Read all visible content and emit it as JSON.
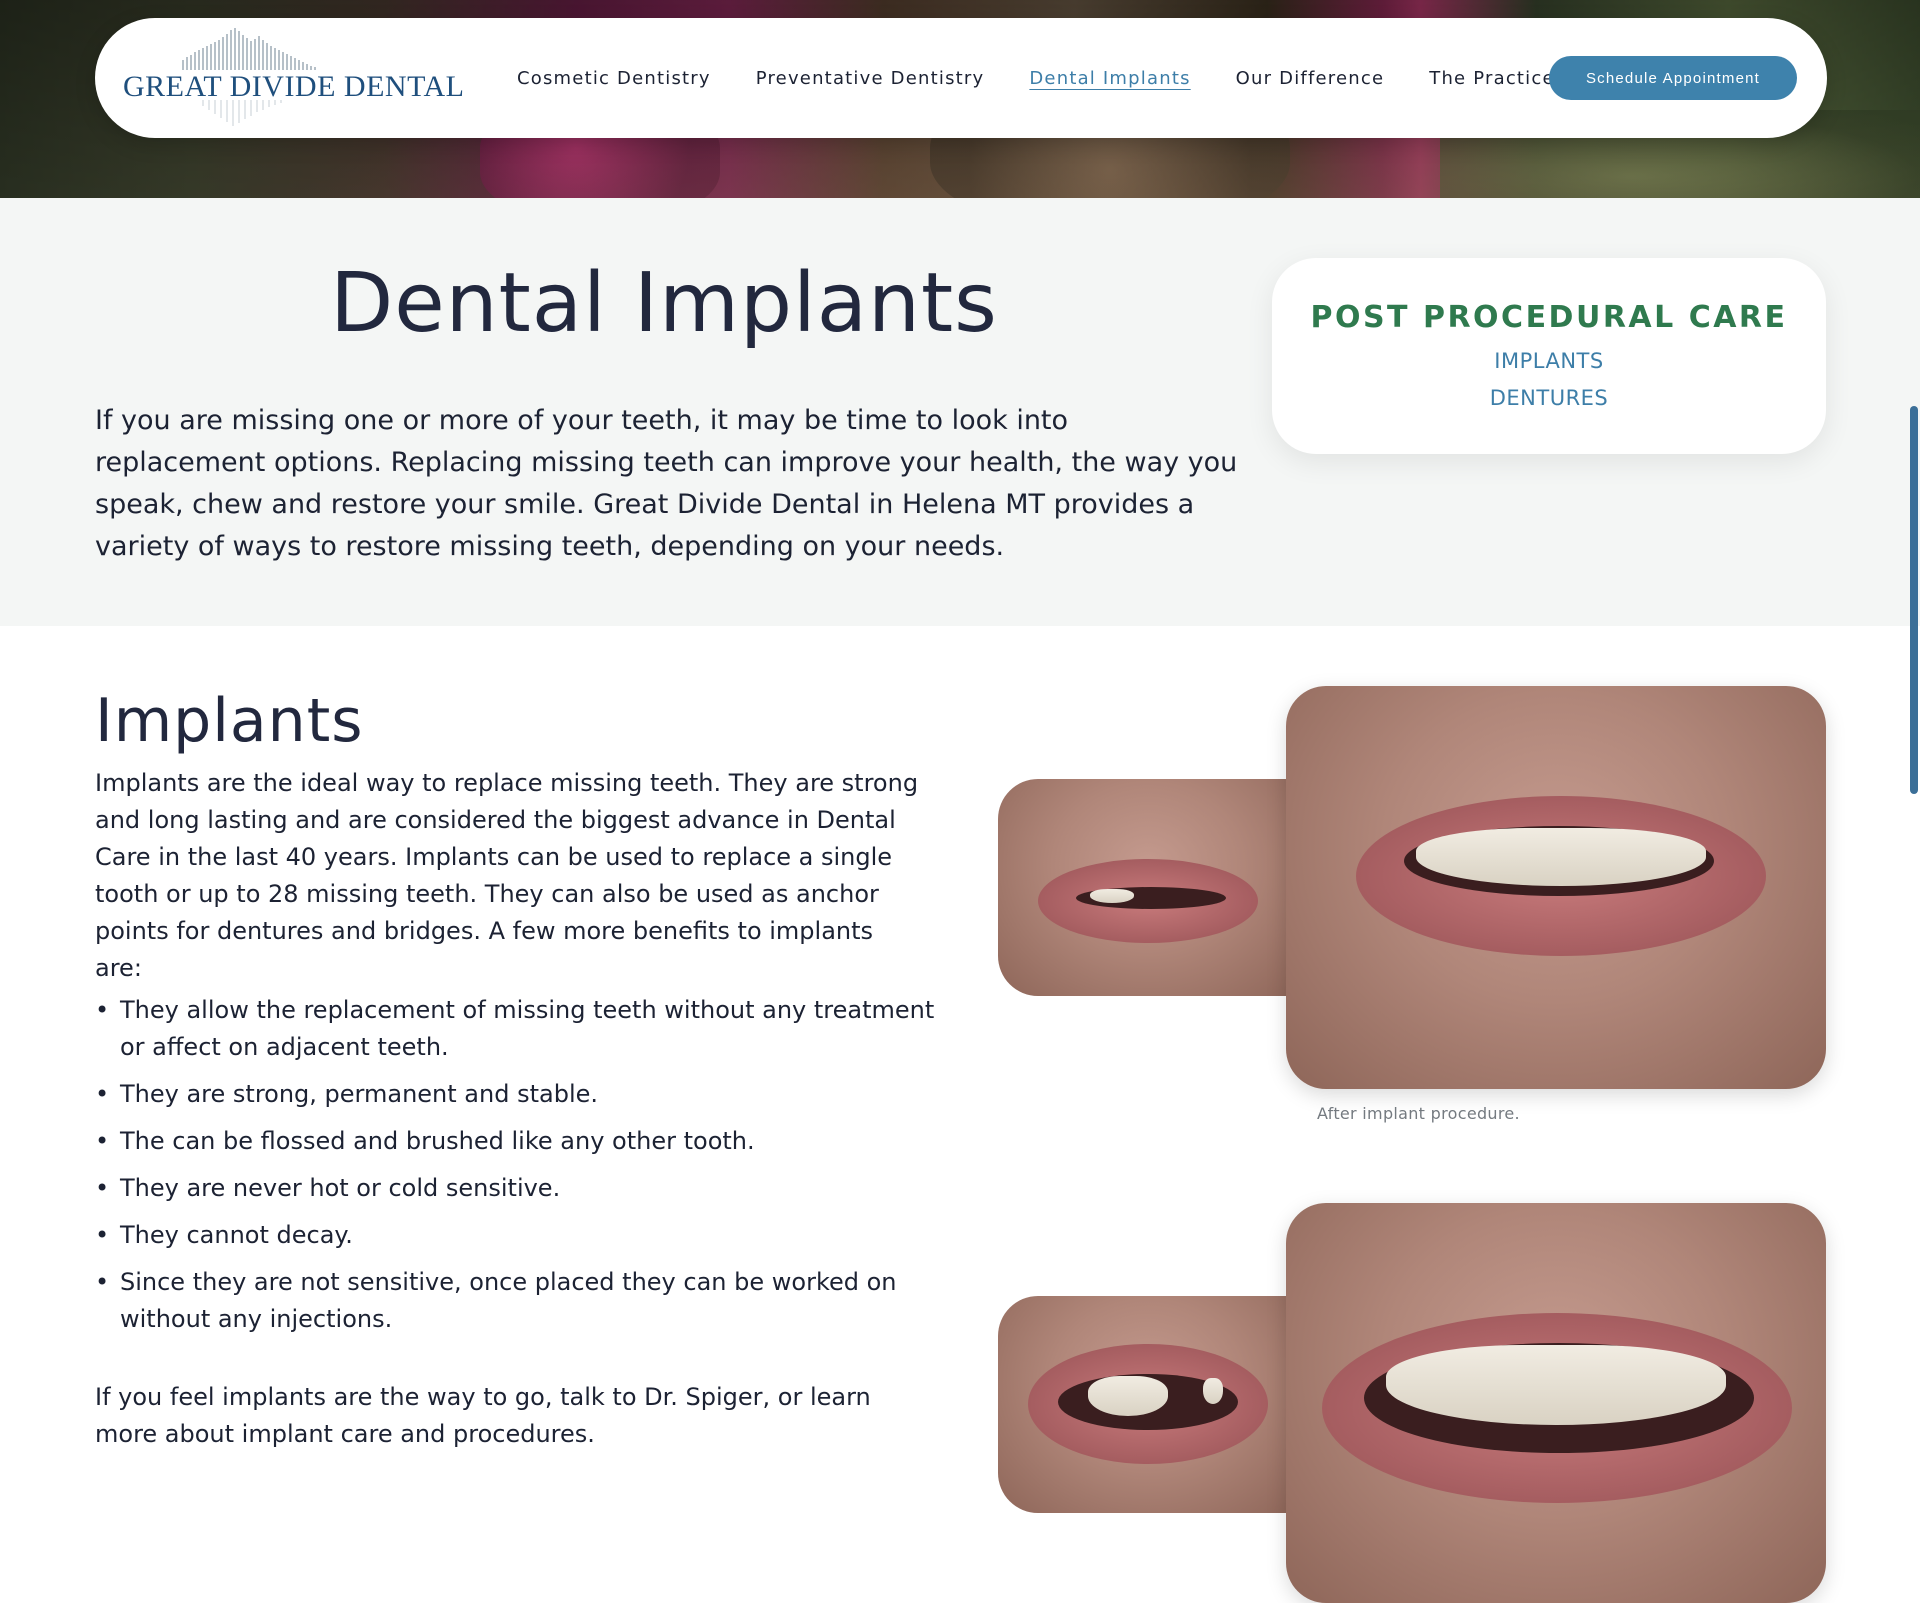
{
  "brand": {
    "name": "Great Divide Dental"
  },
  "logo": {
    "text": "GREAT DIVIDE DENTAL"
  },
  "nav": {
    "items": [
      {
        "label": "Cosmetic Dentistry",
        "active": false
      },
      {
        "label": "Preventative Dentistry",
        "active": false
      },
      {
        "label": "Dental Implants",
        "active": true
      },
      {
        "label": "Our Difference",
        "active": false
      },
      {
        "label": "The Practice",
        "active": false
      }
    ],
    "cta": "Schedule Appointment"
  },
  "intro": {
    "title": "Dental Implants",
    "text": "If you are missing one or more of your teeth, it may be time to look into replacement options. Replacing missing teeth can improve your health, the way you speak, chew and restore your smile. Great Divide Dental in Helena MT provides a variety of ways to restore missing teeth, depending on your needs."
  },
  "care_card": {
    "title": "POST PROCEDURAL CARE",
    "links": [
      "IMPLANTS",
      "DENTURES"
    ]
  },
  "implants": {
    "title": "Implants",
    "text": "Implants are the ideal way to replace missing teeth. They are strong and long lasting and are considered the biggest advance in Dental Care in the last 40 years. Implants can be used to replace a single tooth or up to 28 missing teeth. They can also be used as anchor points for dentures and bridges. A few more benefits to implants are:",
    "benefits": [
      "They allow the replacement of missing teeth without any treatment or affect on adjacent teeth.",
      "They are strong, permanent and stable.",
      "The can be flossed and brushed like any other tooth.",
      "They are never hot or cold sensitive.",
      "They cannot decay.",
      "Since they are not sensitive, once placed they can be worked on without any injections."
    ],
    "closing": "If you feel implants are the way to go, talk to Dr. Spiger, or learn more about implant care and procedures."
  },
  "photos": {
    "caption": "After implant procedure."
  },
  "colors": {
    "accent_blue": "#3e82ac",
    "care_title_green": "#2f7a4e",
    "heading_navy": "#22283e",
    "intro_bg": "#f4f6f5"
  }
}
